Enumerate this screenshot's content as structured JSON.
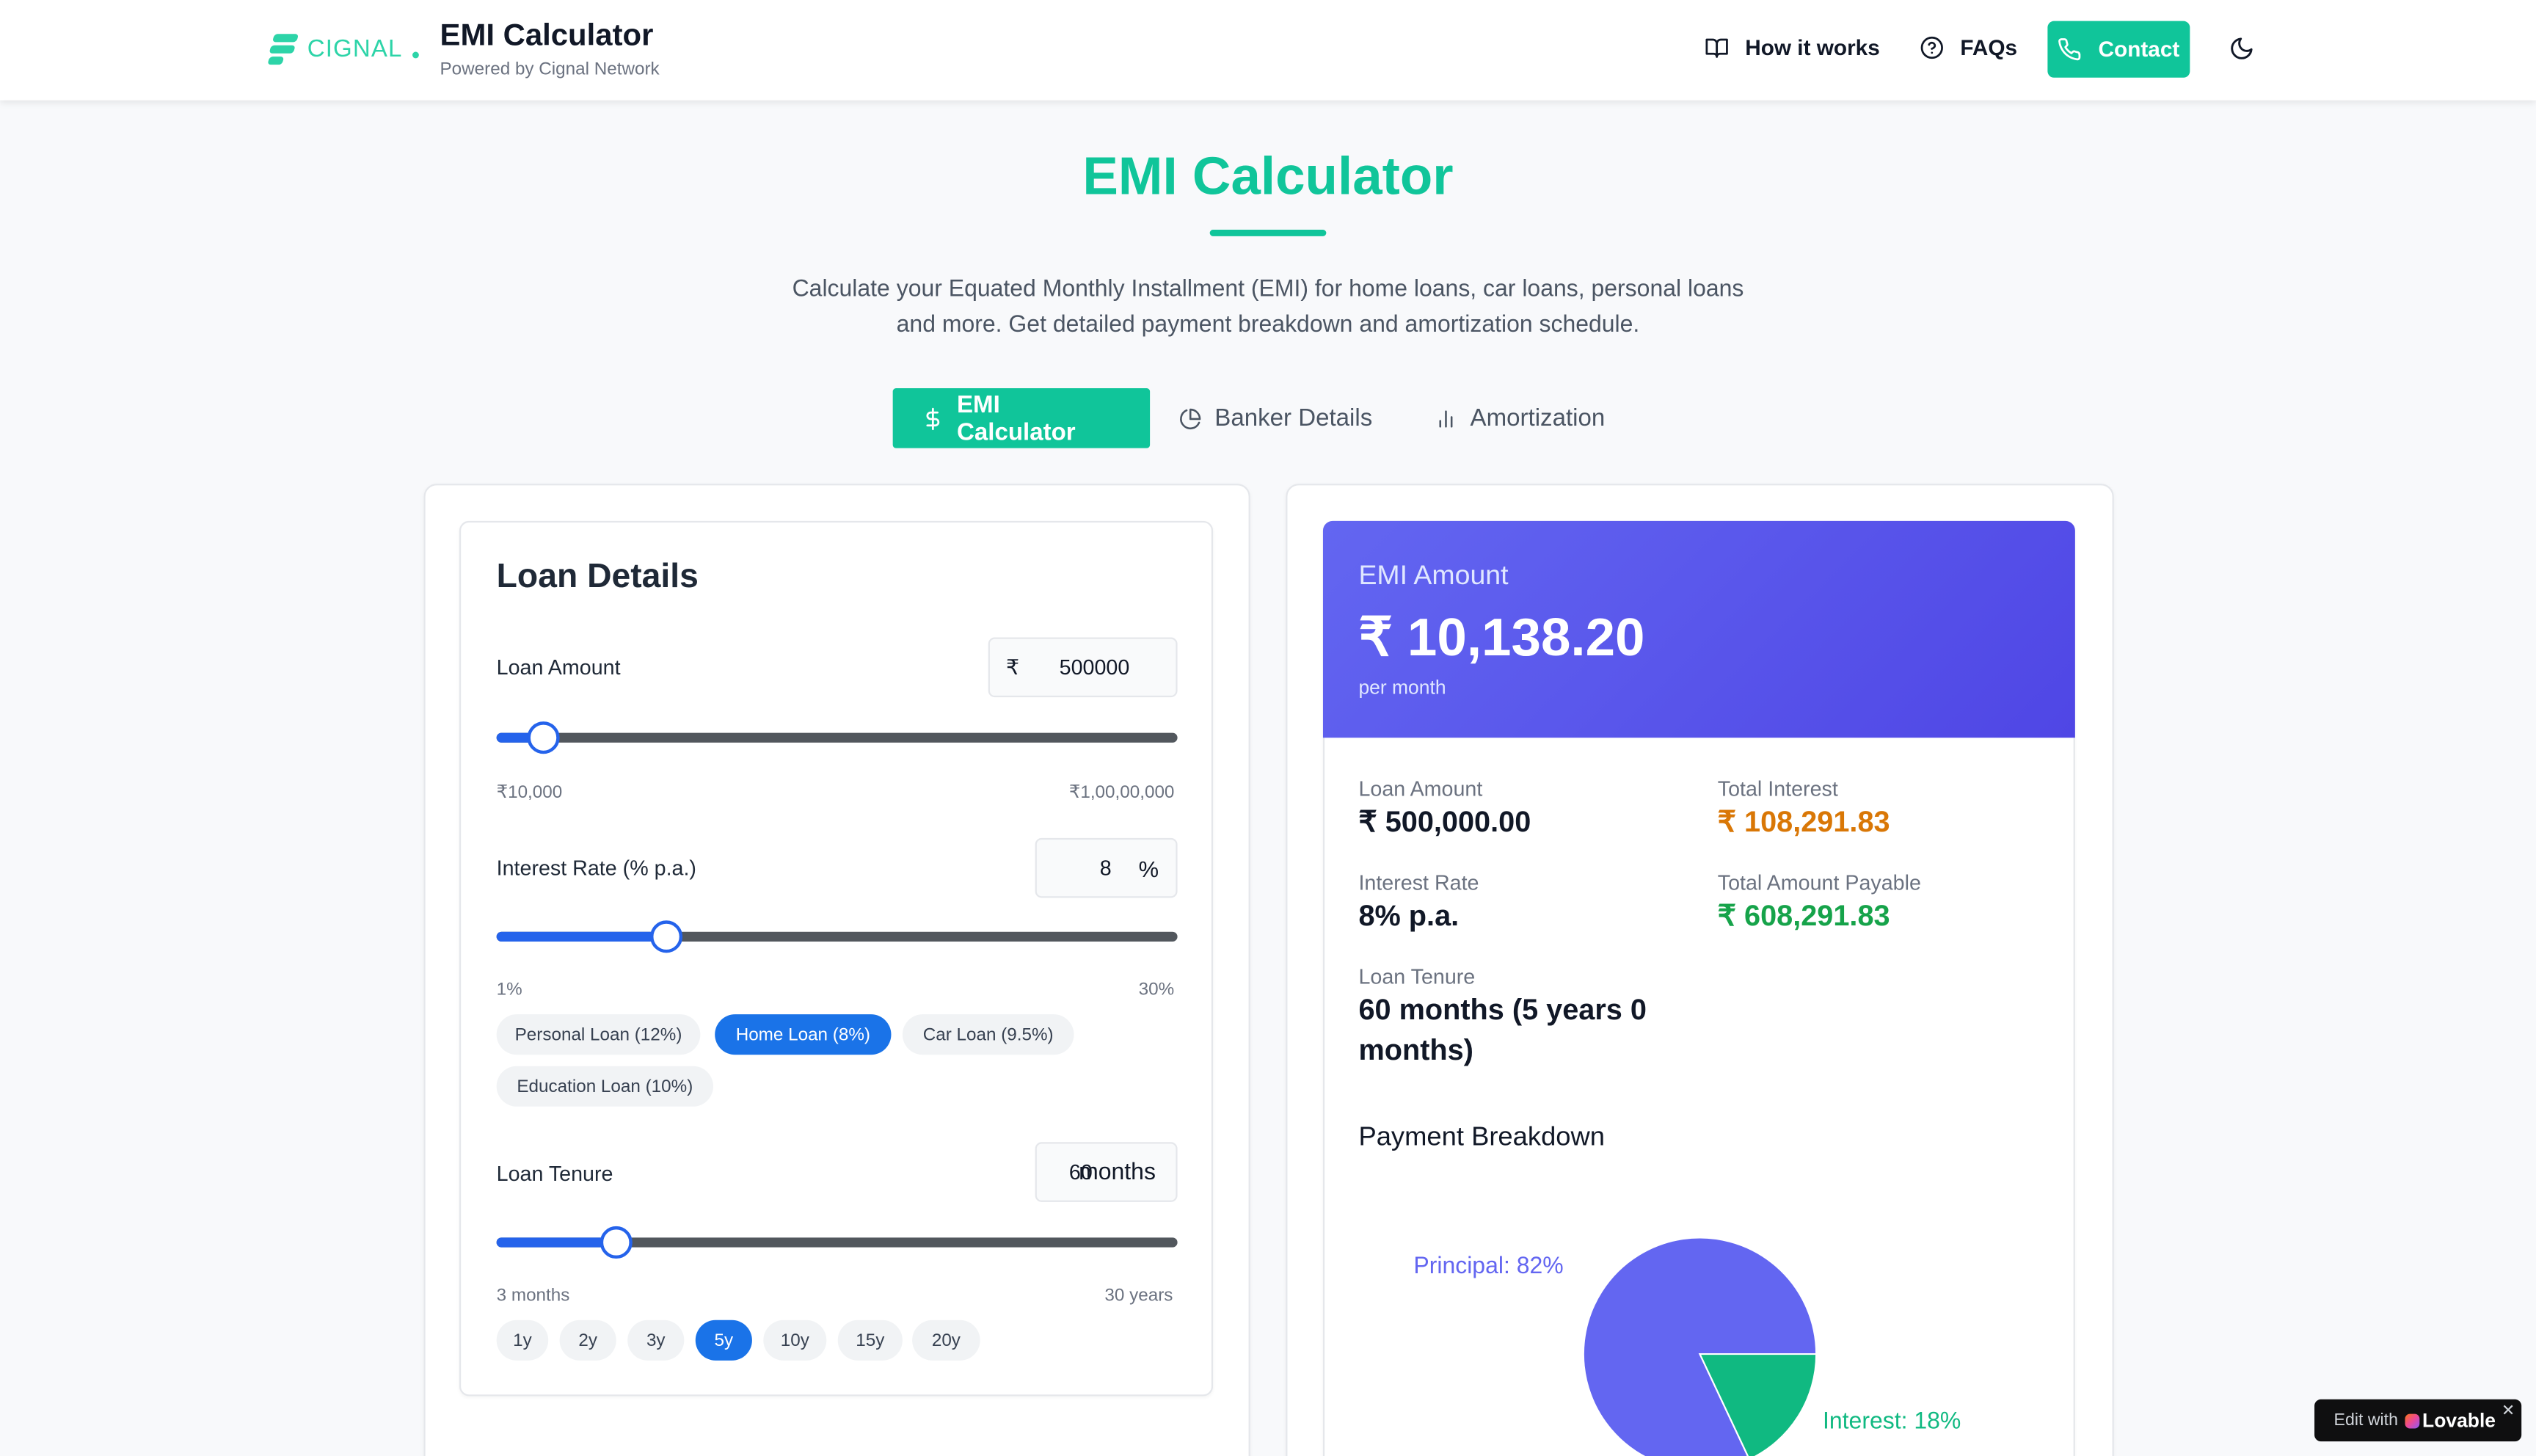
{
  "header": {
    "logo_text": "CIGNAL",
    "title": "EMI Calculator",
    "subtitle": "Powered by Cignal Network",
    "nav": {
      "how": "How it works",
      "faqs": "FAQs",
      "contact": "Contact"
    }
  },
  "hero": {
    "title": "EMI Calculator",
    "description": "Calculate your Equated Monthly Installment (EMI) for home loans, car loans, personal loans and more. Get detailed payment breakdown and amortization schedule."
  },
  "tabs": [
    {
      "label": "EMI Calculator",
      "active": true
    },
    {
      "label": "Banker Details",
      "active": false
    },
    {
      "label": "Amortization",
      "active": false
    }
  ],
  "loan_details": {
    "title": "Loan Details",
    "amount": {
      "label": "Loan Amount",
      "currency": "₹",
      "value": "500000",
      "min": "₹10,000",
      "max": "₹1,00,00,000",
      "slider_fraction": 0.07
    },
    "rate": {
      "label": "Interest Rate (% p.a.)",
      "value": "8",
      "unit": "%",
      "min": "1%",
      "max": "30%",
      "slider_fraction": 0.25
    },
    "rate_presets": [
      "Personal Loan (12%)",
      "Home Loan (8%)",
      "Car Loan (9.5%)",
      "Education Loan (10%)"
    ],
    "rate_preset_active": "Home Loan (8%)",
    "tenure": {
      "label": "Loan Tenure",
      "value": "60",
      "unit": "months",
      "min": "3 months",
      "max": "30 years",
      "slider_fraction": 0.175
    },
    "tenure_presets": [
      "1y",
      "2y",
      "3y",
      "5y",
      "10y",
      "15y",
      "20y"
    ],
    "tenure_preset_active": "5y"
  },
  "result": {
    "emi_label": "EMI Amount",
    "emi_value": "₹ 10,138.20",
    "emi_per": "per month",
    "loan_amount_label": "Loan Amount",
    "loan_amount_value": "₹ 500,000.00",
    "total_interest_label": "Total Interest",
    "total_interest_value": "₹ 108,291.83",
    "interest_rate_label": "Interest Rate",
    "interest_rate_value": "8% p.a.",
    "total_payable_label": "Total Amount Payable",
    "total_payable_value": "₹ 608,291.83",
    "tenure_label": "Loan Tenure",
    "tenure_value_line1": "60 months (5 years 0",
    "tenure_value_line2": "months)",
    "breakdown_title": "Payment Breakdown",
    "pie": {
      "principal_label": "Principal: 82%",
      "interest_label": "Interest: 18%",
      "principal_pct": 82,
      "interest_pct": 18
    },
    "colors": {
      "principal": "#6366f1",
      "interest": "#10b981",
      "interest_text": "#d97706",
      "payable_text": "#16a34a"
    }
  },
  "badge": {
    "edit_with": "Edit with",
    "brand": "Lovable"
  }
}
